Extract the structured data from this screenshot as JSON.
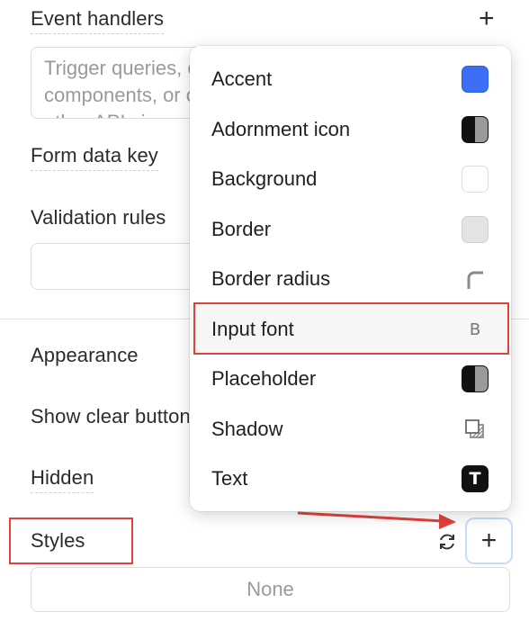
{
  "panel": {
    "event_handlers_label": "Event handlers",
    "event_handlers_placeholder": "Trigger queries, control components, or call other APIs in response to component events.",
    "form_data_key_label": "Form data key",
    "validation_rules_label": "Validation rules",
    "appearance_label": "Appearance",
    "show_clear_button_label": "Show clear button",
    "hidden_label": "Hidden",
    "styles_label": "Styles",
    "styles_value": "None"
  },
  "menu": {
    "items": [
      {
        "label": "Accent",
        "icon": "color-swatch",
        "color": "#3c6ff5"
      },
      {
        "label": "Adornment icon",
        "icon": "half-swatch"
      },
      {
        "label": "Background",
        "icon": "color-swatch",
        "color": "#ffffff"
      },
      {
        "label": "Border",
        "icon": "color-swatch",
        "color": "#e3e3e3"
      },
      {
        "label": "Border radius",
        "icon": "corner-radius-icon"
      },
      {
        "label": "Input font",
        "icon": "font-icon",
        "glyph": "B"
      },
      {
        "label": "Placeholder",
        "icon": "half-swatch"
      },
      {
        "label": "Shadow",
        "icon": "shadow-icon"
      },
      {
        "label": "Text",
        "icon": "text-icon",
        "glyph": "T"
      }
    ]
  },
  "colors": {
    "accent": "#3c6ff5",
    "highlight": "#e0413a",
    "focus_ring": "#c9dcfb"
  }
}
